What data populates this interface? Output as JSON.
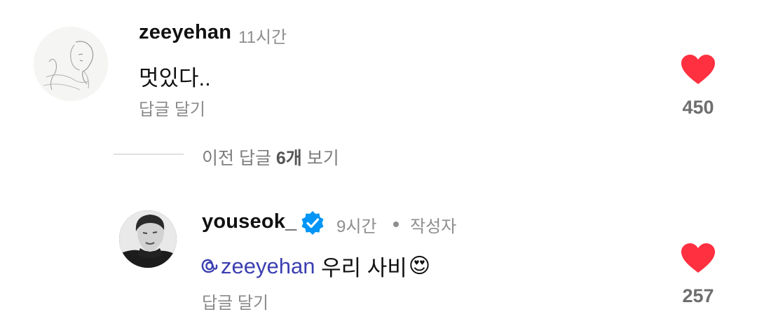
{
  "comments": [
    {
      "username": "zeeyehan",
      "time": "11시간",
      "text": "멋있다..",
      "reply_label": "답글 달기",
      "like_count": "450",
      "avatar_icon": "sketch-portrait-avatar",
      "heart_color": "#ff3040"
    }
  ],
  "view_previous": {
    "prefix": "이전 답글 ",
    "count": "6개",
    "suffix": " 보기"
  },
  "replies": [
    {
      "username": "youseok_",
      "verified_icon": "verified-badge-icon",
      "time": "9시간",
      "author_badge": "작성자",
      "mention_icon": "threads-at-icon",
      "mention": "zeeyehan",
      "text": " 우리 사비",
      "emoji": "😍",
      "reply_label": "답글 달기",
      "like_count": "257",
      "heart_color": "#ff3040"
    }
  ]
}
